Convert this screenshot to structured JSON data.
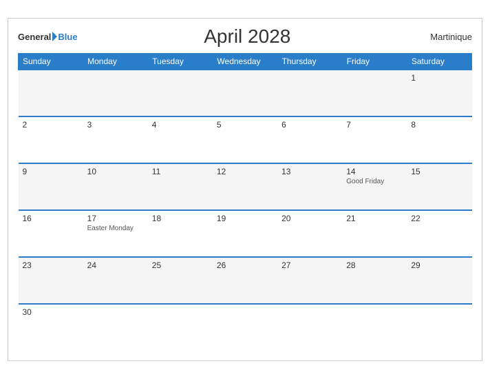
{
  "header": {
    "logo_general": "General",
    "logo_blue": "Blue",
    "title": "April 2028",
    "region": "Martinique"
  },
  "weekdays": [
    "Sunday",
    "Monday",
    "Tuesday",
    "Wednesday",
    "Thursday",
    "Friday",
    "Saturday"
  ],
  "weeks": [
    [
      {
        "day": "",
        "event": ""
      },
      {
        "day": "",
        "event": ""
      },
      {
        "day": "",
        "event": ""
      },
      {
        "day": "",
        "event": ""
      },
      {
        "day": "",
        "event": ""
      },
      {
        "day": "",
        "event": ""
      },
      {
        "day": "1",
        "event": ""
      }
    ],
    [
      {
        "day": "2",
        "event": ""
      },
      {
        "day": "3",
        "event": ""
      },
      {
        "day": "4",
        "event": ""
      },
      {
        "day": "5",
        "event": ""
      },
      {
        "day": "6",
        "event": ""
      },
      {
        "day": "7",
        "event": ""
      },
      {
        "day": "8",
        "event": ""
      }
    ],
    [
      {
        "day": "9",
        "event": ""
      },
      {
        "day": "10",
        "event": ""
      },
      {
        "day": "11",
        "event": ""
      },
      {
        "day": "12",
        "event": ""
      },
      {
        "day": "13",
        "event": ""
      },
      {
        "day": "14",
        "event": "Good Friday"
      },
      {
        "day": "15",
        "event": ""
      }
    ],
    [
      {
        "day": "16",
        "event": ""
      },
      {
        "day": "17",
        "event": "Easter Monday"
      },
      {
        "day": "18",
        "event": ""
      },
      {
        "day": "19",
        "event": ""
      },
      {
        "day": "20",
        "event": ""
      },
      {
        "day": "21",
        "event": ""
      },
      {
        "day": "22",
        "event": ""
      }
    ],
    [
      {
        "day": "23",
        "event": ""
      },
      {
        "day": "24",
        "event": ""
      },
      {
        "day": "25",
        "event": ""
      },
      {
        "day": "26",
        "event": ""
      },
      {
        "day": "27",
        "event": ""
      },
      {
        "day": "28",
        "event": ""
      },
      {
        "day": "29",
        "event": ""
      }
    ],
    [
      {
        "day": "30",
        "event": ""
      },
      {
        "day": "",
        "event": ""
      },
      {
        "day": "",
        "event": ""
      },
      {
        "day": "",
        "event": ""
      },
      {
        "day": "",
        "event": ""
      },
      {
        "day": "",
        "event": ""
      },
      {
        "day": "",
        "event": ""
      }
    ]
  ]
}
